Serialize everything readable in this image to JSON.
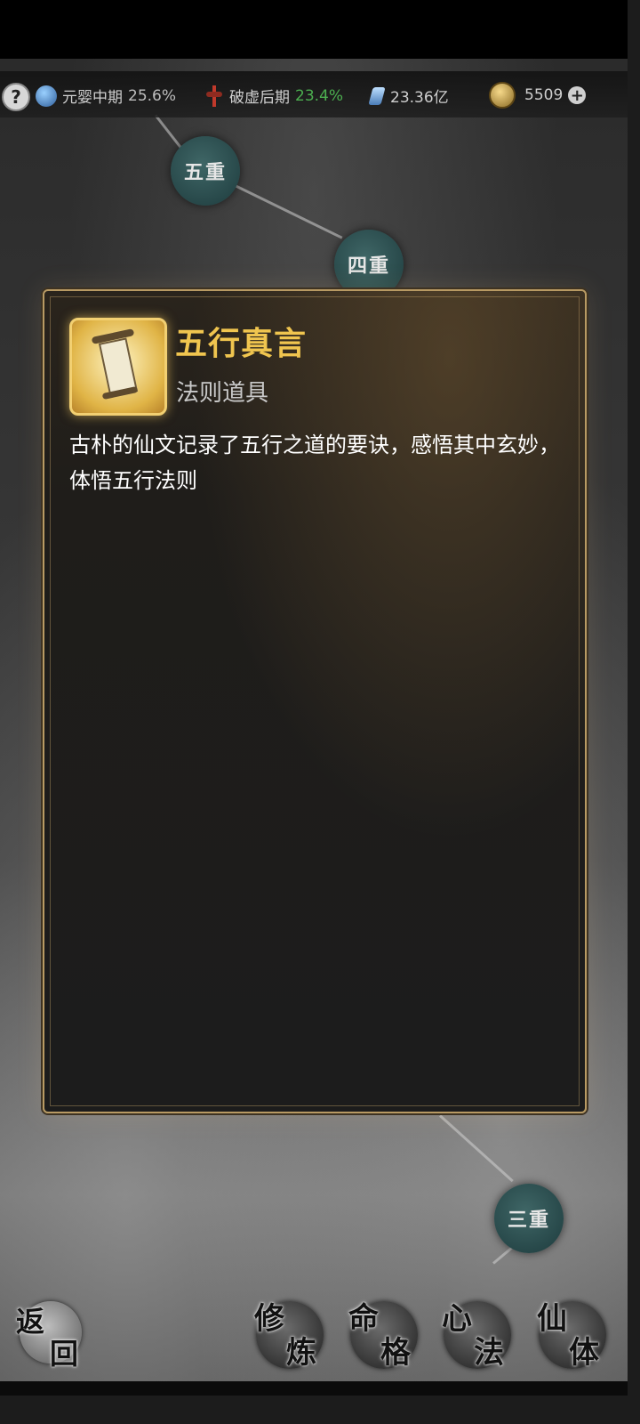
{
  "status": {
    "help": "?",
    "realm": {
      "label": "元婴中期",
      "percent": "25.6%"
    },
    "breakthrough": {
      "label": "破虚后期",
      "percent": "23.4%",
      "percent_color": "#4caf50"
    },
    "spirit_stones": "23.36亿",
    "currency": "5509",
    "plus": "+"
  },
  "map_nodes": {
    "node5": "五重",
    "node4": "四重",
    "node3": "三重"
  },
  "item": {
    "name": "五行真言",
    "type": "法则道具",
    "description": "古朴的仙文记录了五行之道的要诀，感悟其中玄妙，体悟五行法则",
    "icon": "scroll-icon"
  },
  "nav": {
    "back": [
      "返",
      "回"
    ],
    "cultivate": [
      "修",
      "炼"
    ],
    "fate": [
      "命",
      "格"
    ],
    "method": [
      "心",
      "法"
    ],
    "body": [
      "仙",
      "体"
    ]
  }
}
